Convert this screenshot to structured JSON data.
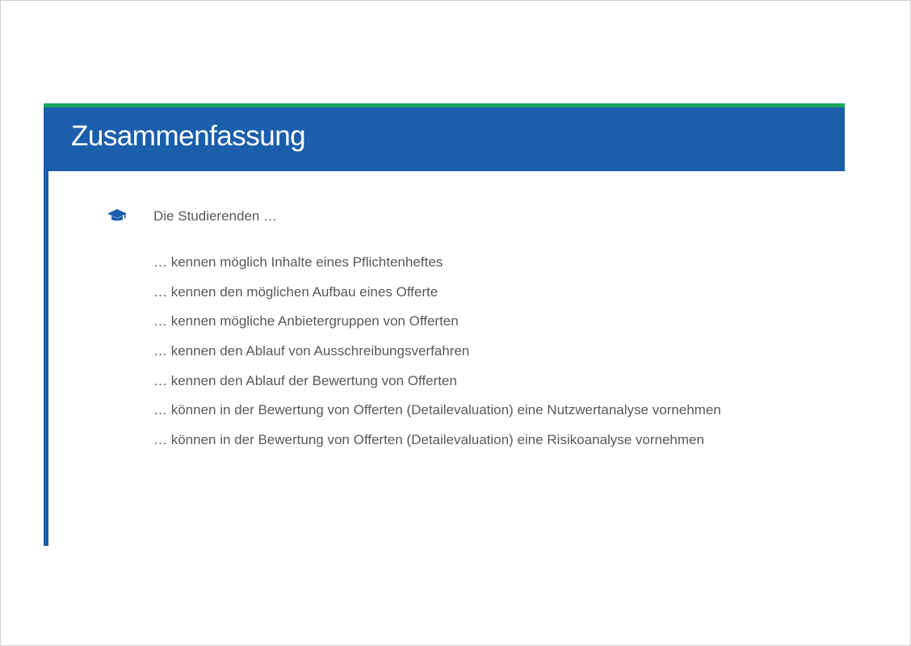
{
  "slide": {
    "title": "Zusammenfassung",
    "intro": "Die Studierenden …",
    "items": [
      "… kennen möglich Inhalte eines Pflichtenheftes",
      "… kennen den möglichen Aufbau eines Offerte",
      "… kennen mögliche Anbietergruppen von Offerten",
      "… kennen den Ablauf von Ausschreibungsverfahren",
      "… kennen den Ablauf der Bewertung von Offerten",
      "… können in der Bewertung von Offerten (Detailevaluation) eine Nutzwertanalyse vornehmen",
      "… können in der Bewertung von Offerten (Detailevaluation) eine Risikoanalyse vornehmen"
    ]
  },
  "icons": {
    "intro": "graduation-cap-icon"
  },
  "colors": {
    "header_band": "#1b5eab",
    "accent_stripe": "#1aa85f",
    "body_text": "#595959",
    "title_text": "#ffffff"
  }
}
